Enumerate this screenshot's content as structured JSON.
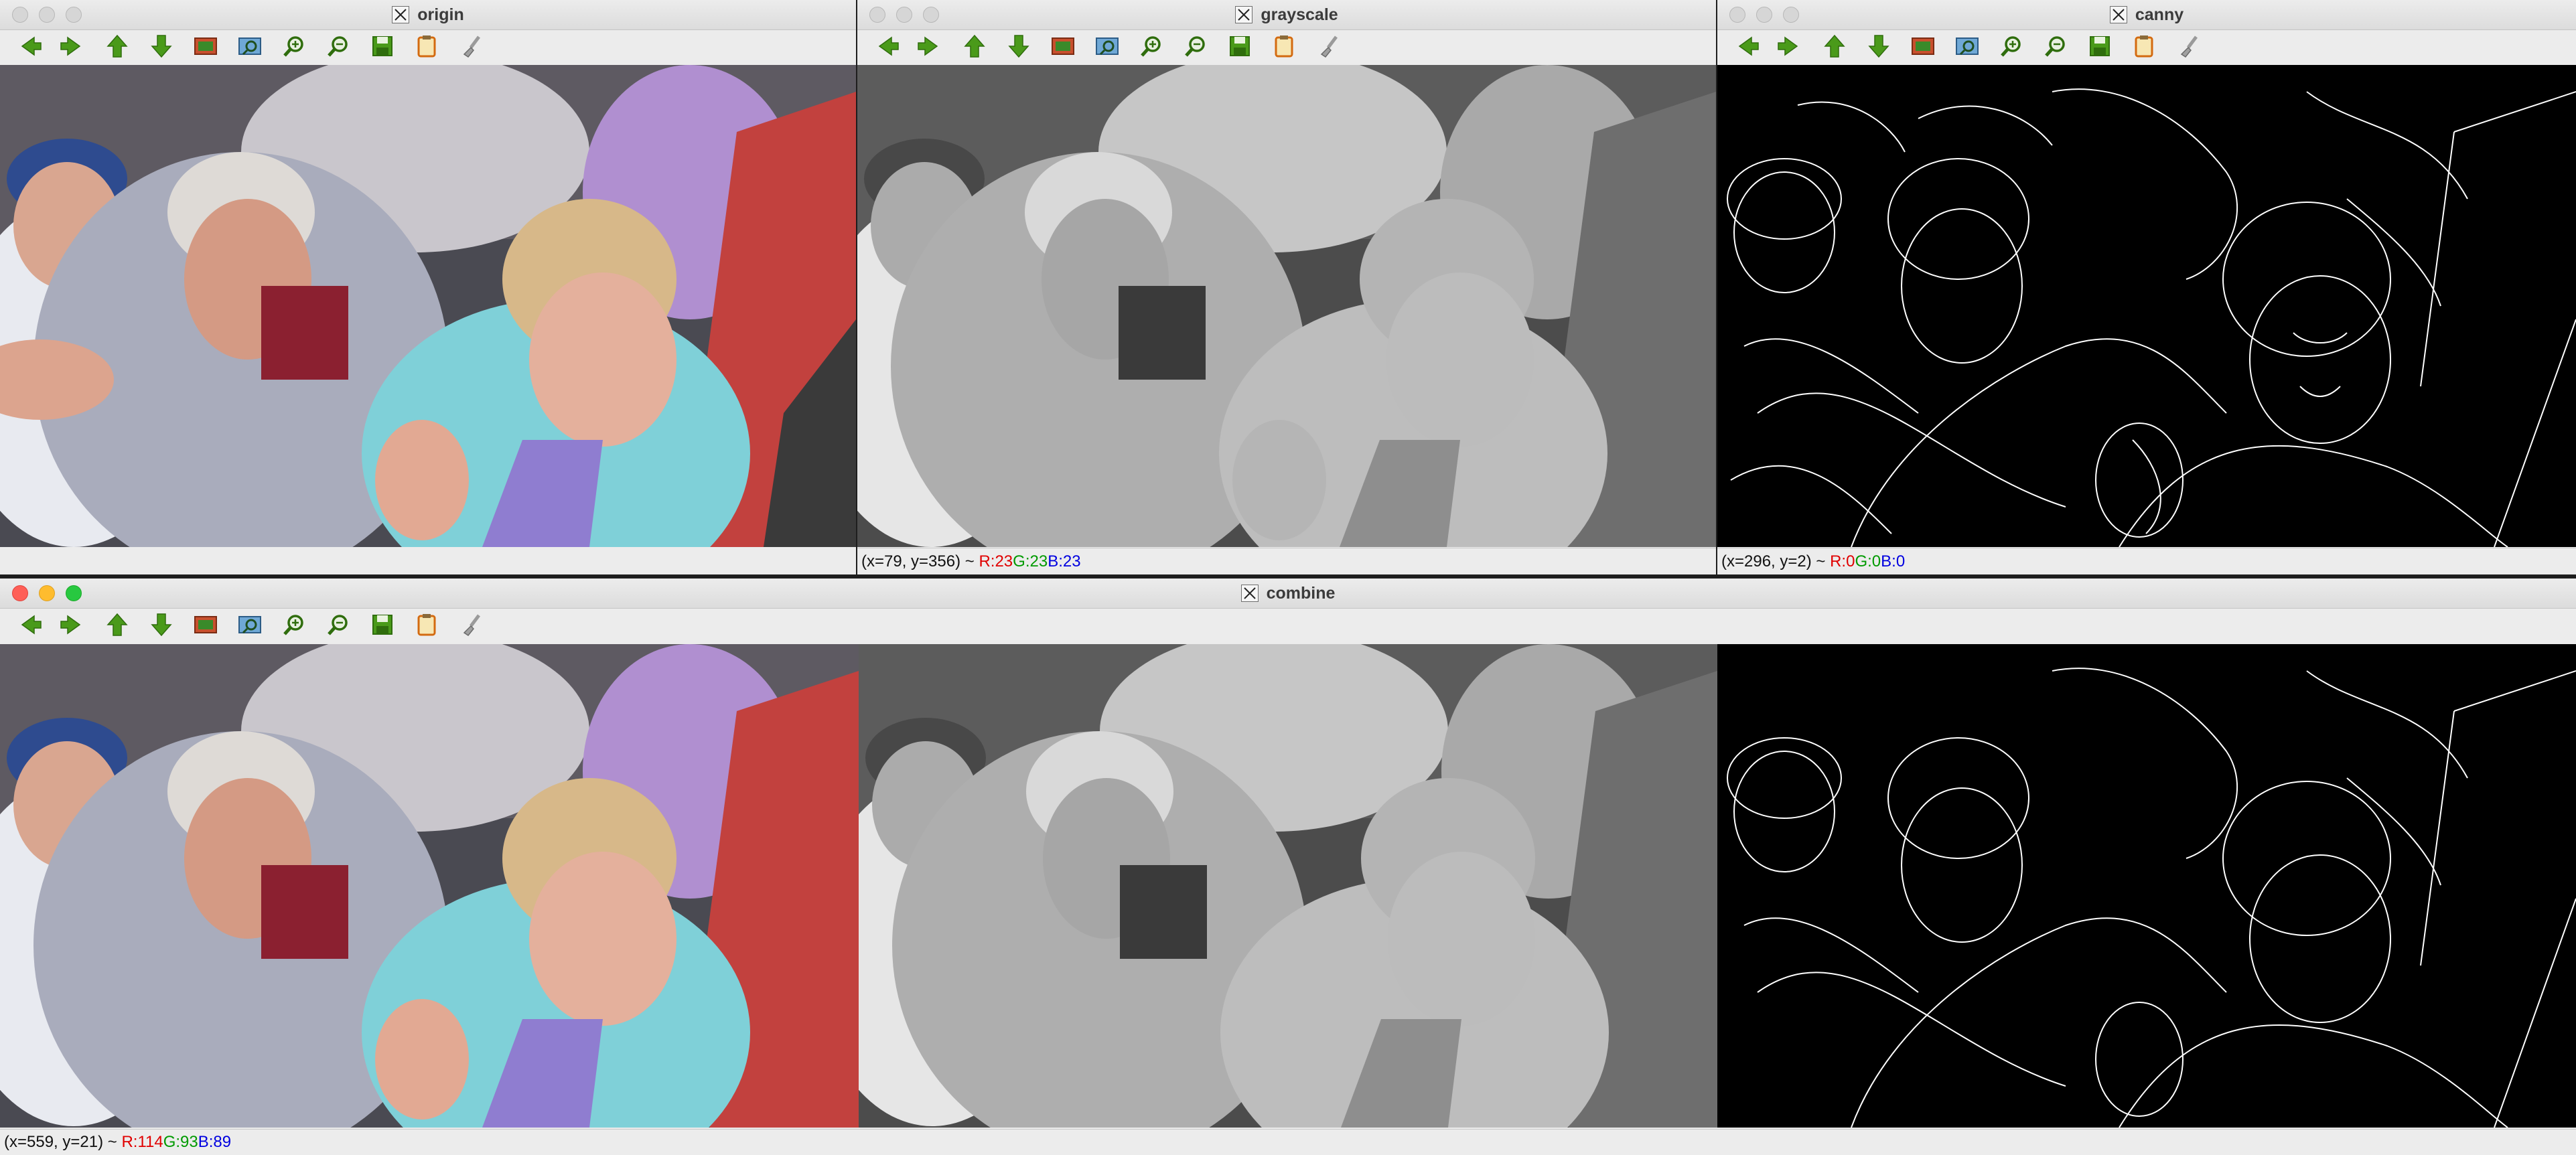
{
  "windows": {
    "origin": {
      "title": "origin"
    },
    "grayscale": {
      "title": "grayscale",
      "status": {
        "coords": "(x=79, y=356) ~ ",
        "r": "R:23",
        "g": "G:23",
        "b": "B:23"
      }
    },
    "canny": {
      "title": "canny",
      "status": {
        "coords": "(x=296, y=2) ~ ",
        "r": "R:0",
        "g": "G:0",
        "b": "B:0"
      }
    },
    "combine": {
      "title": "combine",
      "status": {
        "coords": "(x=559, y=21) ~ ",
        "r": "R:114",
        "g": "G:93",
        "b": "B:89"
      }
    }
  },
  "toolbar_icons": [
    "arrow-left-icon",
    "arrow-right-icon",
    "arrow-up-icon",
    "arrow-down-icon",
    "zoom-image-icon",
    "zoom-fit-icon",
    "zoom-in-icon",
    "zoom-out-icon",
    "save-icon",
    "copy-clipboard-icon",
    "properties-brush-icon"
  ],
  "colors": {
    "toolbar_green": "#4a9a1a",
    "status_red": "#e00000",
    "status_green": "#009a00",
    "status_blue": "#0000e0"
  }
}
